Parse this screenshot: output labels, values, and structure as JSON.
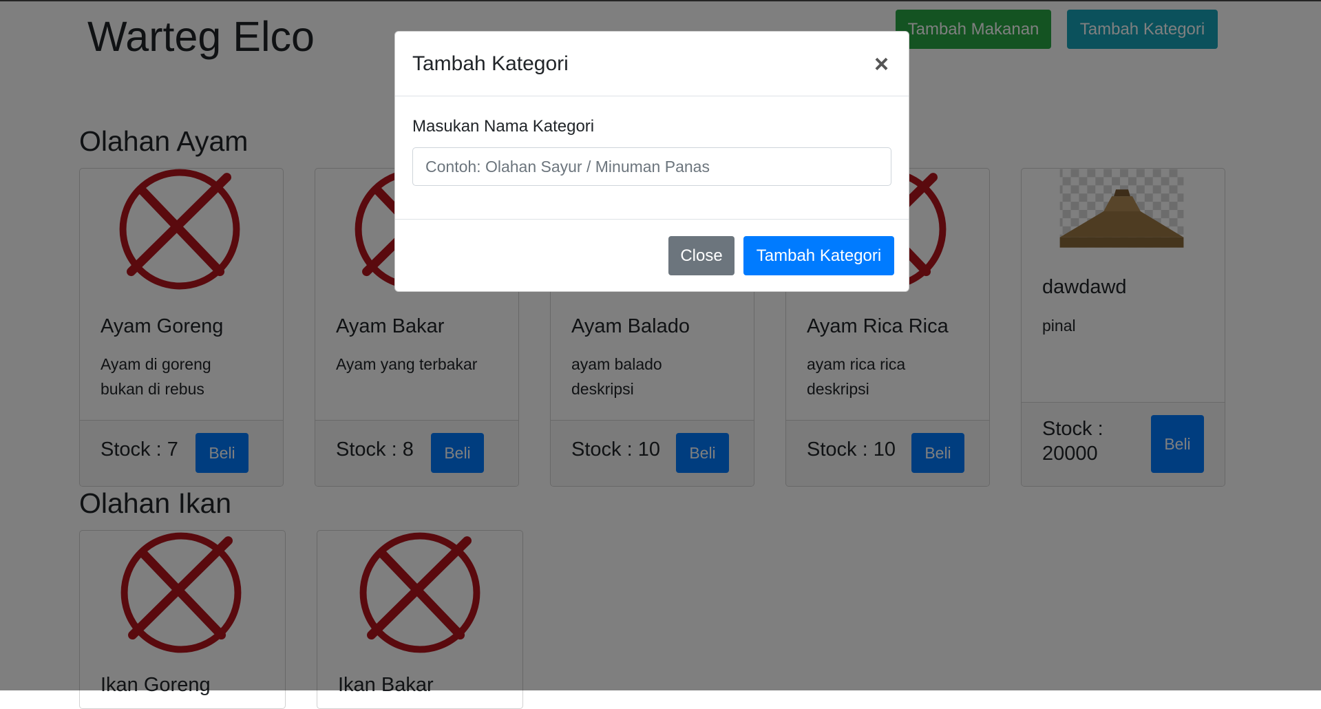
{
  "header": {
    "brand": "Warteg Elco",
    "add_food_label": "Tambah Makanan",
    "add_category_label": "Tambah Kategori"
  },
  "colors": {
    "success": "#28a745",
    "info": "#17a2b8",
    "primary": "#007bff",
    "secondary": "#6c757d",
    "placeholder_mark": "#b5151d"
  },
  "categories": [
    {
      "title": "Olahan Ayam",
      "items": [
        {
          "name": "Ayam Goreng",
          "desc": "Ayam di goreng bukan di rebus",
          "stock": "Stock : 7",
          "buy": "Beli",
          "image": "red-x-icon"
        },
        {
          "name": "Ayam Bakar",
          "desc": "Ayam yang terbakar",
          "stock": "Stock : 8",
          "buy": "Beli",
          "image": "red-x-icon"
        },
        {
          "name": "Ayam Balado",
          "desc": "ayam balado deskripsi",
          "stock": "Stock : 10",
          "buy": "Beli",
          "image": "red-x-icon"
        },
        {
          "name": "Ayam Rica Rica",
          "desc": "ayam rica rica deskripsi",
          "stock": "Stock : 10",
          "buy": "Beli",
          "image": "red-x-icon"
        },
        {
          "name": "dawdawd",
          "desc": "pinal",
          "stock": "Stock : 20000",
          "buy": "Beli",
          "image": "pyramid-photo"
        }
      ]
    },
    {
      "title": "Olahan Ikan",
      "items": [
        {
          "name": "Ikan Goreng",
          "image": "red-x-icon"
        },
        {
          "name": "Ikan Bakar",
          "image": "red-x-icon"
        }
      ]
    }
  ],
  "modal": {
    "title": "Tambah Kategori",
    "close_symbol": "×",
    "label": "Masukan Nama Kategori",
    "placeholder": "Contoh: Olahan Sayur / Minuman Panas",
    "close_label": "Close",
    "submit_label": "Tambah Kategori"
  }
}
